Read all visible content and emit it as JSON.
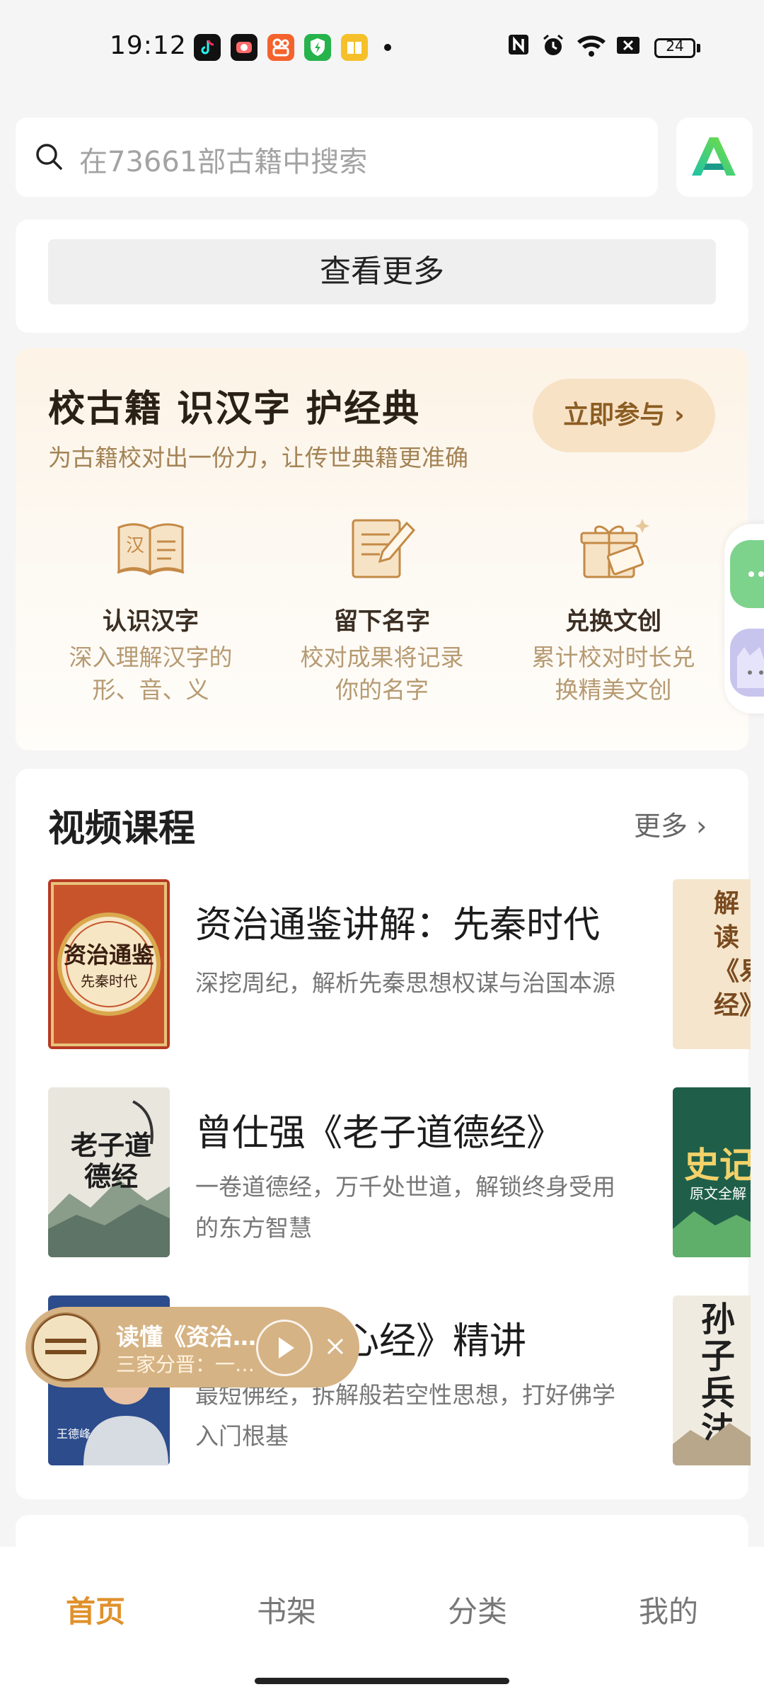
{
  "status_bar": {
    "time": "19:12",
    "battery": "24"
  },
  "search": {
    "placeholder": "在73661部古籍中搜索"
  },
  "top_section": {
    "more_button": "查看更多"
  },
  "proofread": {
    "title": "校古籍 识汉字 护经典",
    "subtitle": "为古籍校对出一份力，让传世典籍更准确",
    "join_button": "立即参与",
    "features": [
      {
        "icon": "book-icon",
        "title": "认识汉字",
        "desc": [
          "深入理解汉字的",
          "形、音、义"
        ]
      },
      {
        "icon": "notepad-pen-icon",
        "title": "留下名字",
        "desc": [
          "校对成果将记录",
          "你的名字"
        ]
      },
      {
        "icon": "gift-box-icon",
        "title": "兑换文创",
        "desc": [
          "累计校对时长兑",
          "换精美文创"
        ]
      }
    ]
  },
  "video_courses": {
    "heading": "视频课程",
    "more": "更多",
    "items": [
      {
        "title": "资治通鉴讲解：先秦时代",
        "desc": [
          "深挖周纪，解析先秦思想权谋与治国本源"
        ],
        "cover_main": "资治通鉴",
        "cover_sub": "先秦时代",
        "right_cover_text": "解读《易经》"
      },
      {
        "title": "曾仕强《老子道德经》",
        "desc": [
          "一卷道德经，万千处世道，解锁终身受用",
          "的东方智慧"
        ],
        "cover_main": "老子道德经",
        "right_cover_text": "史记",
        "right_cover_sub": "原文全解"
      },
      {
        "title": "王德峰《心经》精讲",
        "visible_title": "峰《心经》精讲",
        "desc": [
          "最短佛经，拆解般若空性思想，打好佛学",
          "入门根基"
        ],
        "cover_name": "王德峰",
        "right_cover_text": "孙子兵法"
      }
    ]
  },
  "mini_player": {
    "title": "读懂《资治…",
    "subtitle": "三家分晋：一…"
  },
  "tabs": [
    {
      "label": "首页",
      "active": true
    },
    {
      "label": "书架",
      "active": false
    },
    {
      "label": "分类",
      "active": false
    },
    {
      "label": "我的",
      "active": false
    }
  ],
  "colors": {
    "accent": "#e0912c",
    "gold": "#a38355",
    "button_bg": "#f7e2c6"
  }
}
